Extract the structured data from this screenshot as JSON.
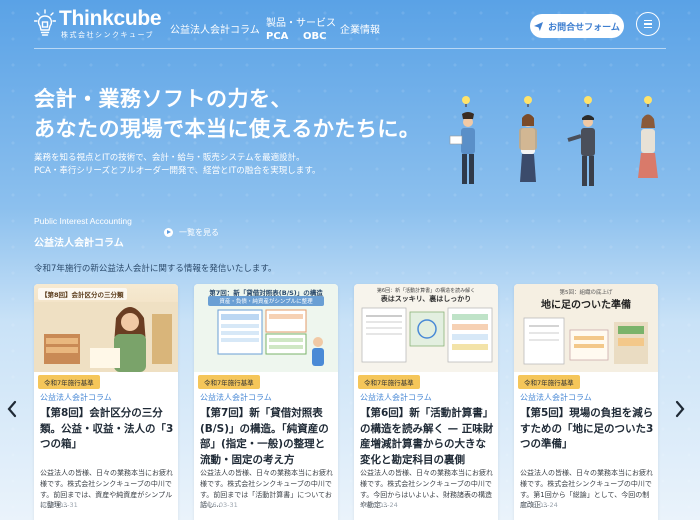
{
  "header": {
    "logo_text": "Thinkcube",
    "logo_sub": "株式会社シンクキューブ",
    "nav": {
      "column": "公益法人会計コラム",
      "products": "製品・サービス",
      "pca": "PCA",
      "obc": "OBC",
      "company": "企業情報"
    },
    "contact_label": "お問合せフォーム"
  },
  "hero": {
    "title_line1": "会計・業務ソフトの力を、",
    "title_line2": "あなたの現場で本当に使えるかたちに。",
    "desc_line1": "業務を知る視点とITの技術で、会計・給与・販売システムを最適設計。",
    "desc_line2": "PCA・奉行シリーズとフルオーダー開発で、経営とITの融合を実現します。"
  },
  "section": {
    "title_en": "Public Interest Accounting",
    "title_jp": "公益法人会計コラム",
    "see_all": "一覧を見る",
    "desc": "令和7年施行の新公益法人会計に関する情報を発信いたします。"
  },
  "cards": [
    {
      "badge": "令和7年施行基準",
      "category": "公益法人会計コラム",
      "title": "【第8回】会計区分の三分類。公益・収益・法人の「3つの箱」",
      "body": "公益法人の皆様、日々の業務本当にお疲れ様です。株式会社シンクキューブの中川です。前回までは、資産や純資産がシンプルに整理...",
      "date": "2026-03-31",
      "img_caption": "【第8回】会計区分の三分類"
    },
    {
      "badge": "令和7年施行基準",
      "category": "公益法人会計コラム",
      "title": "【第7回】新「貸借対照表(B/S)」の構造。「純資産の部」(指定・一般)の整理と流動・固定の考え方",
      "body": "公益法人の皆様、日々の業務本当にお疲れ様です。株式会社シンクキューブの中川です。前回までは「活動計算書」についてお話し...",
      "date": "2026-03-31",
      "img_caption": "第7回：新「貸借対照表(B/S)」の構造",
      "img_sub": "資産・負債・純資産がシンプルに整理"
    },
    {
      "badge": "令和7年施行基準",
      "category": "公益法人会計コラム",
      "title": "【第6回】新「活動計算書」の構造を読み解く — 正味財産増減計算書からの大きな変化と勘定科目の裏側",
      "body": "公益法人の皆様、日々の業務本当にお疲れ様です。株式会社シンクキューブの中川です。今回からはいよいよ、財務諸表の構造や勘定...",
      "date": "2026-03-24",
      "img_caption": "第6回：新「活動計算書」の構造を読み解く",
      "img_sub": "表はスッキリ、裏はしっかり"
    },
    {
      "badge": "令和7年施行基準",
      "category": "公益法人会計コラム",
      "title": "【第5回】現場の負担を減らすための「地に足のついた3つの準備」",
      "body": "公益法人の皆様、日々の業務本当にお疲れ様です。株式会社シンクキューブの中川です。第1回から「総論」として、今回の制度改正...",
      "date": "2026-03-24",
      "img_caption": "第5回：組織の底上げ",
      "img_sub": "地に足のついた準備"
    }
  ],
  "colors": {
    "accent": "#4a8ad6",
    "badge": "#f5c65a"
  }
}
